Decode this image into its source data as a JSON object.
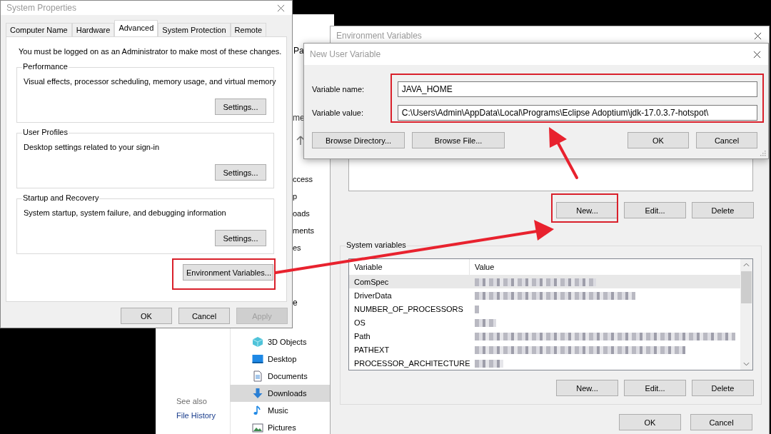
{
  "explorer": {
    "address_fragment": "Pa",
    "column_fragment": "me",
    "quick_access": [
      "ccess",
      "p",
      "oads",
      "ments",
      "es"
    ],
    "lower_fragment": "e",
    "folders": [
      {
        "label": "3D Objects",
        "kind": "cube",
        "selected": false
      },
      {
        "label": "Desktop",
        "kind": "desktop",
        "selected": false
      },
      {
        "label": "Documents",
        "kind": "document",
        "selected": false
      },
      {
        "label": "Downloads",
        "kind": "download",
        "selected": true
      },
      {
        "label": "Music",
        "kind": "music",
        "selected": false
      },
      {
        "label": "Pictures",
        "kind": "pictures",
        "selected": false
      }
    ],
    "see_also": {
      "heading": "See also",
      "links": [
        "File History"
      ]
    }
  },
  "system_properties": {
    "title": "System Properties",
    "tabs": [
      {
        "label": "Computer Name",
        "selected": false
      },
      {
        "label": "Hardware",
        "selected": false
      },
      {
        "label": "Advanced",
        "selected": true
      },
      {
        "label": "System Protection",
        "selected": false
      },
      {
        "label": "Remote",
        "selected": false
      }
    ],
    "notice": "You must be logged on as an Administrator to make most of these changes.",
    "groups": [
      {
        "title": "Performance",
        "description": "Visual effects, processor scheduling, memory usage, and virtual memory",
        "button": "Settings..."
      },
      {
        "title": "User Profiles",
        "description": "Desktop settings related to your sign-in",
        "button": "Settings..."
      },
      {
        "title": "Startup and Recovery",
        "description": "System startup, system failure, and debugging information",
        "button": "Settings..."
      }
    ],
    "env_button": "Environment Variables...",
    "buttons": [
      {
        "label": "OK",
        "disabled": false
      },
      {
        "label": "Cancel",
        "disabled": false
      },
      {
        "label": "Apply",
        "disabled": true
      }
    ]
  },
  "environment_variables": {
    "title": "Environment Variables",
    "user_buttons": [
      "New...",
      "Edit...",
      "Delete"
    ],
    "system_variables": {
      "title": "System variables",
      "columns": [
        "Variable",
        "Value"
      ],
      "rows": [
        {
          "name": "ComSpec",
          "selected": true
        },
        {
          "name": "DriverData",
          "selected": false
        },
        {
          "name": "NUMBER_OF_PROCESSORS",
          "selected": false
        },
        {
          "name": "OS",
          "selected": false
        },
        {
          "name": "Path",
          "selected": false
        },
        {
          "name": "PATHEXT",
          "selected": false
        },
        {
          "name": "PROCESSOR_ARCHITECTURE",
          "selected": false
        }
      ],
      "buttons": [
        "New...",
        "Edit...",
        "Delete"
      ]
    },
    "buttons": [
      "OK",
      "Cancel"
    ]
  },
  "new_user_variable": {
    "title": "New User Variable",
    "fields": [
      {
        "label": "Variable name:",
        "value": "JAVA_HOME"
      },
      {
        "label": "Variable value:",
        "value": "C:\\Users\\Admin\\AppData\\Local\\Programs\\Eclipse Adoptium\\jdk-17.0.3.7-hotspot\\"
      }
    ],
    "left_buttons": [
      "Browse Directory...",
      "Browse File..."
    ],
    "right_buttons": [
      "OK",
      "Cancel"
    ]
  }
}
